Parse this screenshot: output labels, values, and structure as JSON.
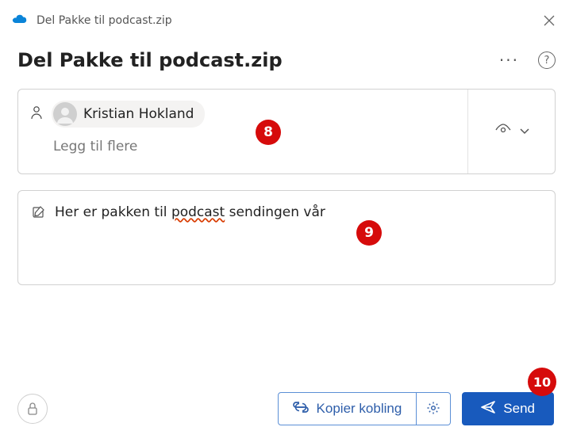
{
  "titlebar": {
    "text": "Del Pakke til podcast.zip"
  },
  "header": {
    "title": "Del Pakke til podcast.zip"
  },
  "recipients": {
    "chip_name": "Kristian Hokland",
    "add_more_label": "Legg til flere"
  },
  "message": {
    "pre": "Her er pakken til ",
    "err_word": "podcast",
    "post": " sendingen vår"
  },
  "footer": {
    "copy_label": "Kopier kobling",
    "send_label": "Send"
  },
  "annotations": {
    "a8": "8",
    "a9": "9",
    "a10": "10"
  }
}
